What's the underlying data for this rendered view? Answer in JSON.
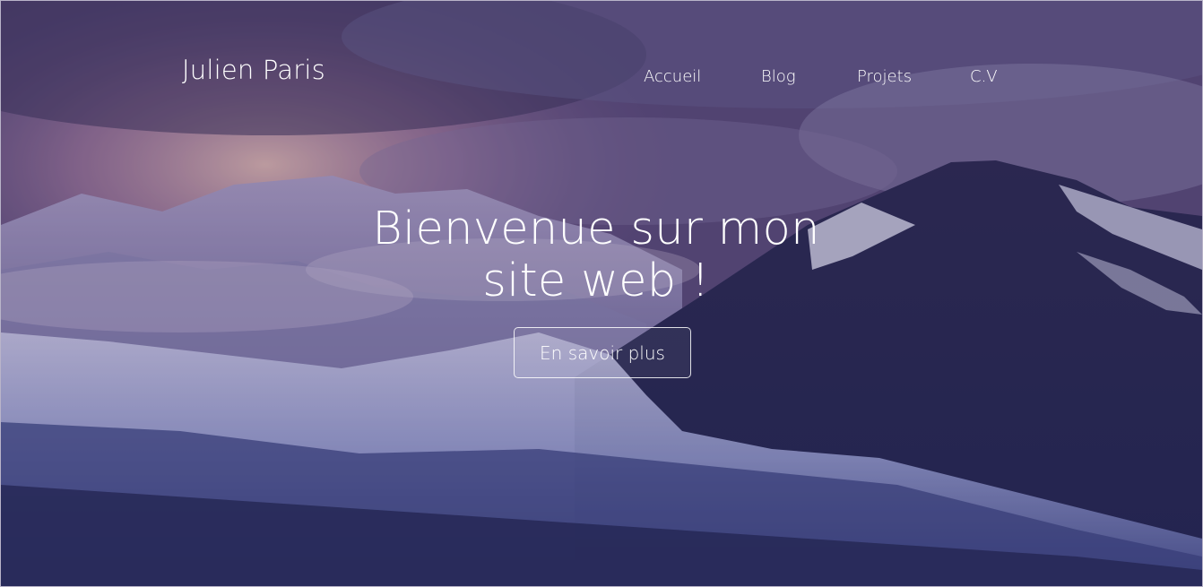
{
  "header": {
    "brand": "Julien Paris",
    "nav": [
      {
        "label": "Accueil"
      },
      {
        "label": "Blog"
      },
      {
        "label": "Projets"
      },
      {
        "label": "C.V"
      }
    ]
  },
  "hero": {
    "headline_line1": "Bienvenue sur mon",
    "headline_line2": "site web !",
    "cta_label": "En savoir plus"
  },
  "colors": {
    "overlay": "#2a2460",
    "text": "#ffffff"
  }
}
